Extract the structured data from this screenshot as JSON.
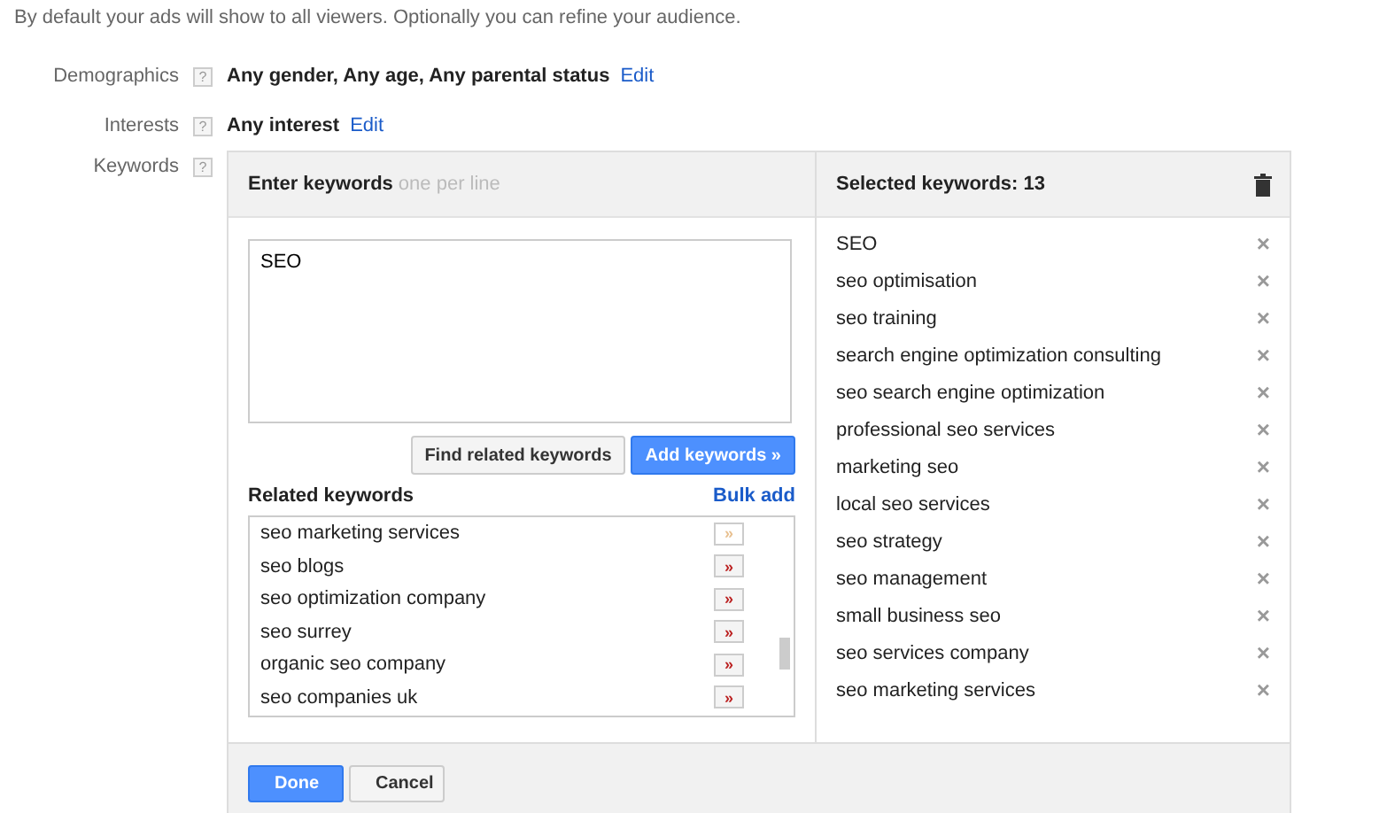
{
  "intro": "By default your ads will show to all viewers. Optionally you can refine your audience.",
  "settings": [
    {
      "label": "Demographics",
      "help": "?",
      "value": "Any gender, Any age, Any parental status",
      "link": "Edit"
    },
    {
      "label": "Interests",
      "help": "?",
      "value": "Any interest",
      "link": "Edit"
    }
  ],
  "keywords": {
    "label": "Keywords",
    "help": "?",
    "enter": {
      "title": "Enter keywords",
      "hint": "one per line",
      "value": "SEO",
      "buttons": [
        {
          "label": "Find related keywords",
          "kind": "secondary"
        },
        {
          "label": "Add keywords »",
          "kind": "primary"
        }
      ]
    },
    "related": {
      "title": "Related keywords",
      "link": "Bulk add",
      "add_label": "»",
      "items": [
        {
          "text": "seo marketing services",
          "added": true
        },
        {
          "text": "seo blogs",
          "added": false
        },
        {
          "text": "seo optimization company",
          "added": false
        },
        {
          "text": "seo surrey",
          "added": false
        },
        {
          "text": "organic seo company",
          "added": false
        },
        {
          "text": "seo companies uk",
          "added": false
        }
      ]
    },
    "selected": {
      "title": "Selected keywords: 13",
      "remove_label": "×",
      "items": [
        "SEO",
        "seo optimisation",
        "seo training",
        "search engine optimization consulting",
        "seo search engine optimization",
        "professional seo services",
        "marketing seo",
        "local seo services",
        "seo strategy",
        "seo management",
        "small business seo",
        "seo services company",
        "seo marketing services"
      ]
    },
    "footer": [
      {
        "label": "Done",
        "kind": "primary"
      },
      {
        "label": "Cancel",
        "kind": "secondary"
      }
    ]
  }
}
